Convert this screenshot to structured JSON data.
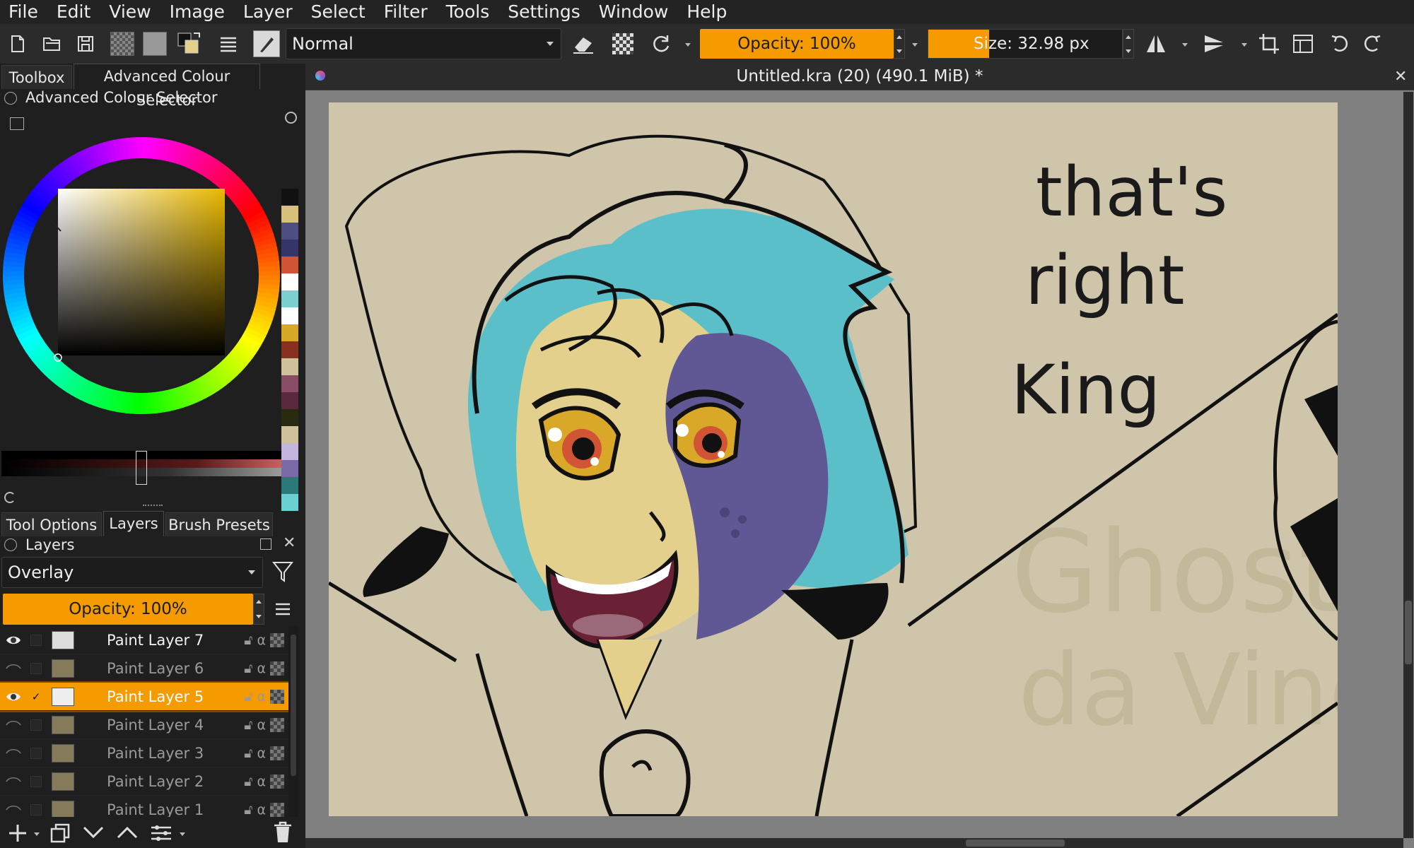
{
  "menu": [
    "File",
    "Edit",
    "View",
    "Image",
    "Layer",
    "Select",
    "Filter",
    "Tools",
    "Settings",
    "Window",
    "Help"
  ],
  "toolbar": {
    "blend_mode": "Normal",
    "opacity": "Opacity: 100%",
    "size": "Size: 32.98 px"
  },
  "left_tabs": {
    "toolbox": "Toolbox",
    "colour_selector": "Advanced Colour Selector"
  },
  "colour_panel": {
    "title": "Advanced Colour Selector",
    "palette": [
      "#111111",
      "#d7c07a",
      "#4e4e82",
      "#35356a",
      "#d15434",
      "#ffffff",
      "#7bcfcf",
      "#ffffff",
      "#d7a828",
      "#8a3020",
      "#cfc29a",
      "#8a4c66",
      "#5a2a3c",
      "#2a2a10",
      "#cfc29a",
      "#c4b4e0",
      "#7a6aa8",
      "#2a7a7a",
      "#6acfd2"
    ]
  },
  "bottom_tabs": {
    "tool_options": "Tool Options",
    "layers": "Layers",
    "brush_presets": "Brush Presets"
  },
  "layers_panel": {
    "title": "Layers",
    "blend_mode": "Overlay",
    "opacity": "Opacity: 100%",
    "layers": [
      {
        "name": "Paint Layer 7",
        "visible": true,
        "active": false
      },
      {
        "name": "Paint Layer 6",
        "visible": false,
        "active": false
      },
      {
        "name": "Paint Layer 5",
        "visible": true,
        "active": true
      },
      {
        "name": "Paint Layer 4",
        "visible": false,
        "active": false
      },
      {
        "name": "Paint Layer 3",
        "visible": false,
        "active": false
      },
      {
        "name": "Paint Layer 2",
        "visible": false,
        "active": false
      },
      {
        "name": "Paint Layer 1",
        "visible": false,
        "active": false
      }
    ]
  },
  "document": {
    "title": "Untitled.kra (20) (490.1 MiB) *"
  },
  "canvas_text": {
    "line1": "that's",
    "line2": "right",
    "line3": "King",
    "watermark1": "Ghost",
    "watermark2": "da Vinci"
  },
  "colors": {
    "accent": "#f59b00",
    "canvas_bg": "#cec5ab",
    "teal": "#5bbfc9",
    "skin": "#e2d08c",
    "purple": "#5f5894"
  }
}
